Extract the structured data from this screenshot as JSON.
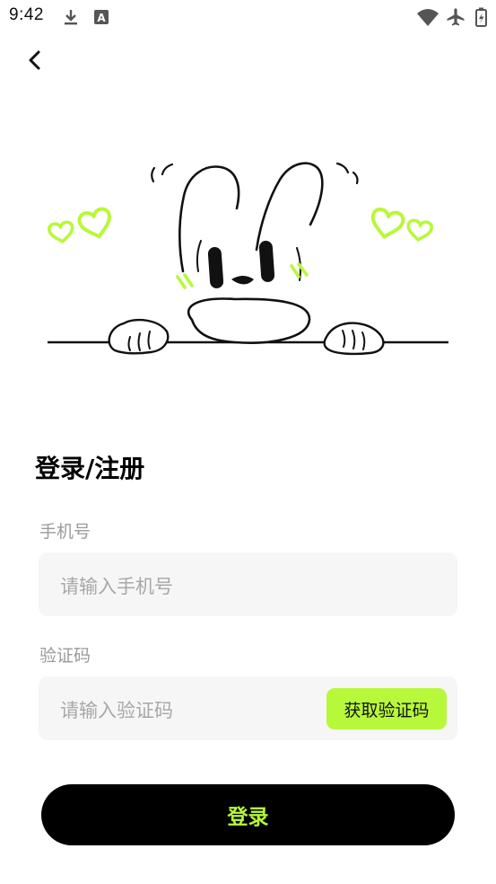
{
  "status_bar": {
    "time": "9:42",
    "left_icons": [
      "download-icon",
      "keyboard-a-icon"
    ],
    "right_icons": [
      "wifi-icon",
      "airplane-icon",
      "battery-icon"
    ]
  },
  "nav": {
    "back_icon": "chevron-left-icon"
  },
  "hero": {
    "illustration": "bunny-peeking-over-line",
    "accent_color": "#b8f83a"
  },
  "form": {
    "title": "登录/注册",
    "phone": {
      "label": "手机号",
      "placeholder": "请输入手机号"
    },
    "code": {
      "label": "验证码",
      "placeholder": "请输入验证码",
      "button_label": "获取验证码"
    },
    "login_label": "登录"
  },
  "colors": {
    "accent": "#b8f83a",
    "field_bg": "#f6f6f6",
    "primary_button": "#000000"
  }
}
